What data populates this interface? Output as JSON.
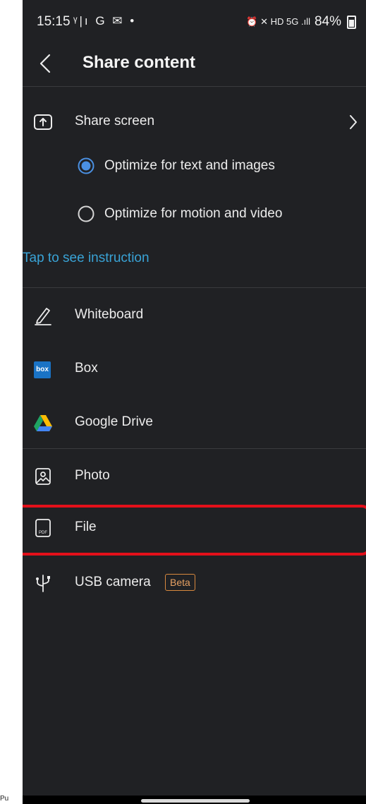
{
  "status_bar": {
    "time": "15:15",
    "left_icons": "ᵞ|ı G ✉ •",
    "right_icons": "⏰ ✕ HD 5G .ıll",
    "battery": "84%"
  },
  "header": {
    "title": "Share content"
  },
  "share_screen": {
    "label": "Share screen",
    "options": [
      {
        "label": "Optimize for text and images",
        "selected": true
      },
      {
        "label": "Optimize for motion and video",
        "selected": false
      }
    ],
    "instruction_link": "Tap to see instruction"
  },
  "items": [
    {
      "label": "Whiteboard",
      "icon": "pencil-icon"
    },
    {
      "label": "Box",
      "icon": "box-logo",
      "logo_text": "box"
    },
    {
      "label": "Google Drive",
      "icon": "google-drive-icon"
    },
    {
      "label": "Photo",
      "icon": "photo-icon"
    },
    {
      "label": "File",
      "icon": "pdf-file-icon",
      "icon_text": "PDF"
    },
    {
      "label": "USB camera",
      "icon": "usb-icon",
      "badge": "Beta"
    }
  ],
  "outside_label": "Pu",
  "colors": {
    "background": "#202124",
    "accent": "#39a3d6",
    "highlight": "#e3101a",
    "badge": "#d8893e"
  }
}
